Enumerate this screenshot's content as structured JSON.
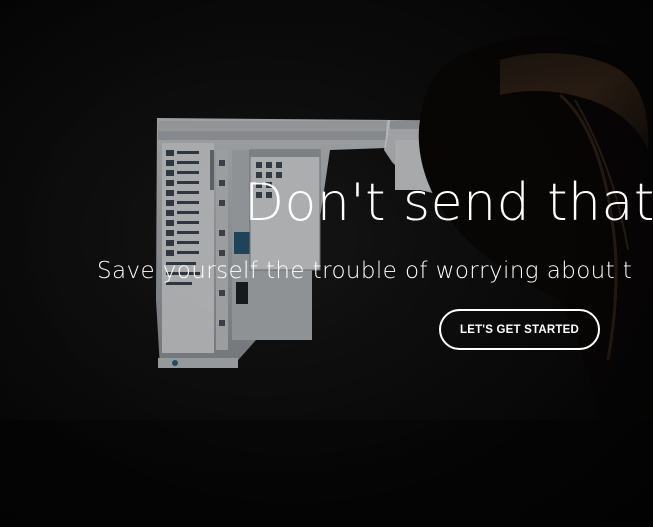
{
  "hero": {
    "headline": "Don't send that e",
    "subheadline": "Save yourself the trouble of worrying about t",
    "cta_label": "LET'S GET STARTED"
  },
  "background": {
    "description_icon": "monitor-with-editor-photo",
    "tint_color": "#0b0b0b"
  }
}
